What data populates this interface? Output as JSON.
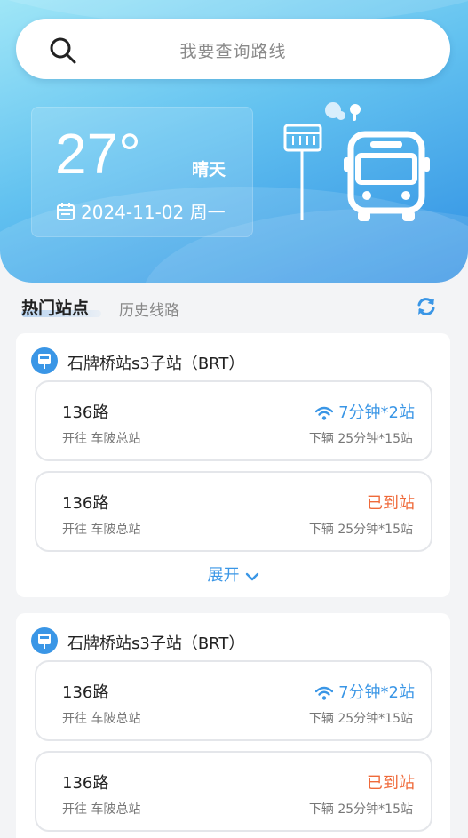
{
  "search": {
    "placeholder": "我要查询路线",
    "icon": "search-icon"
  },
  "weather": {
    "temperature": "27°",
    "condition": "晴天",
    "date": "2024-11-02 周一"
  },
  "tabs": {
    "active": "热门站点",
    "inactive": "历史线路"
  },
  "colors": {
    "accent": "#3a96e6",
    "arrived": "#ef6a3a",
    "hero_top": "#9fe6f7",
    "hero_bottom": "#2f8fe3"
  },
  "stations": [
    {
      "name": "石牌桥站s3子站（BRT）",
      "routes": [
        {
          "number": "136路",
          "direction": "开往 车陂总站",
          "eta": "7分钟*2站",
          "next": "下辆 25分钟*15站"
        },
        {
          "number": "136路",
          "direction": "开往 车陂总站",
          "eta": "已到站",
          "next": "下辆 25分钟*15站"
        }
      ],
      "expand_label": "展开"
    },
    {
      "name": "石牌桥站s3子站（BRT）",
      "routes": [
        {
          "number": "136路",
          "direction": "开往 车陂总站",
          "eta": "7分钟*2站",
          "next": "下辆 25分钟*15站"
        },
        {
          "number": "136路",
          "direction": "开往 车陂总站",
          "eta": "已到站",
          "next": "下辆 25分钟*15站"
        }
      ]
    }
  ]
}
